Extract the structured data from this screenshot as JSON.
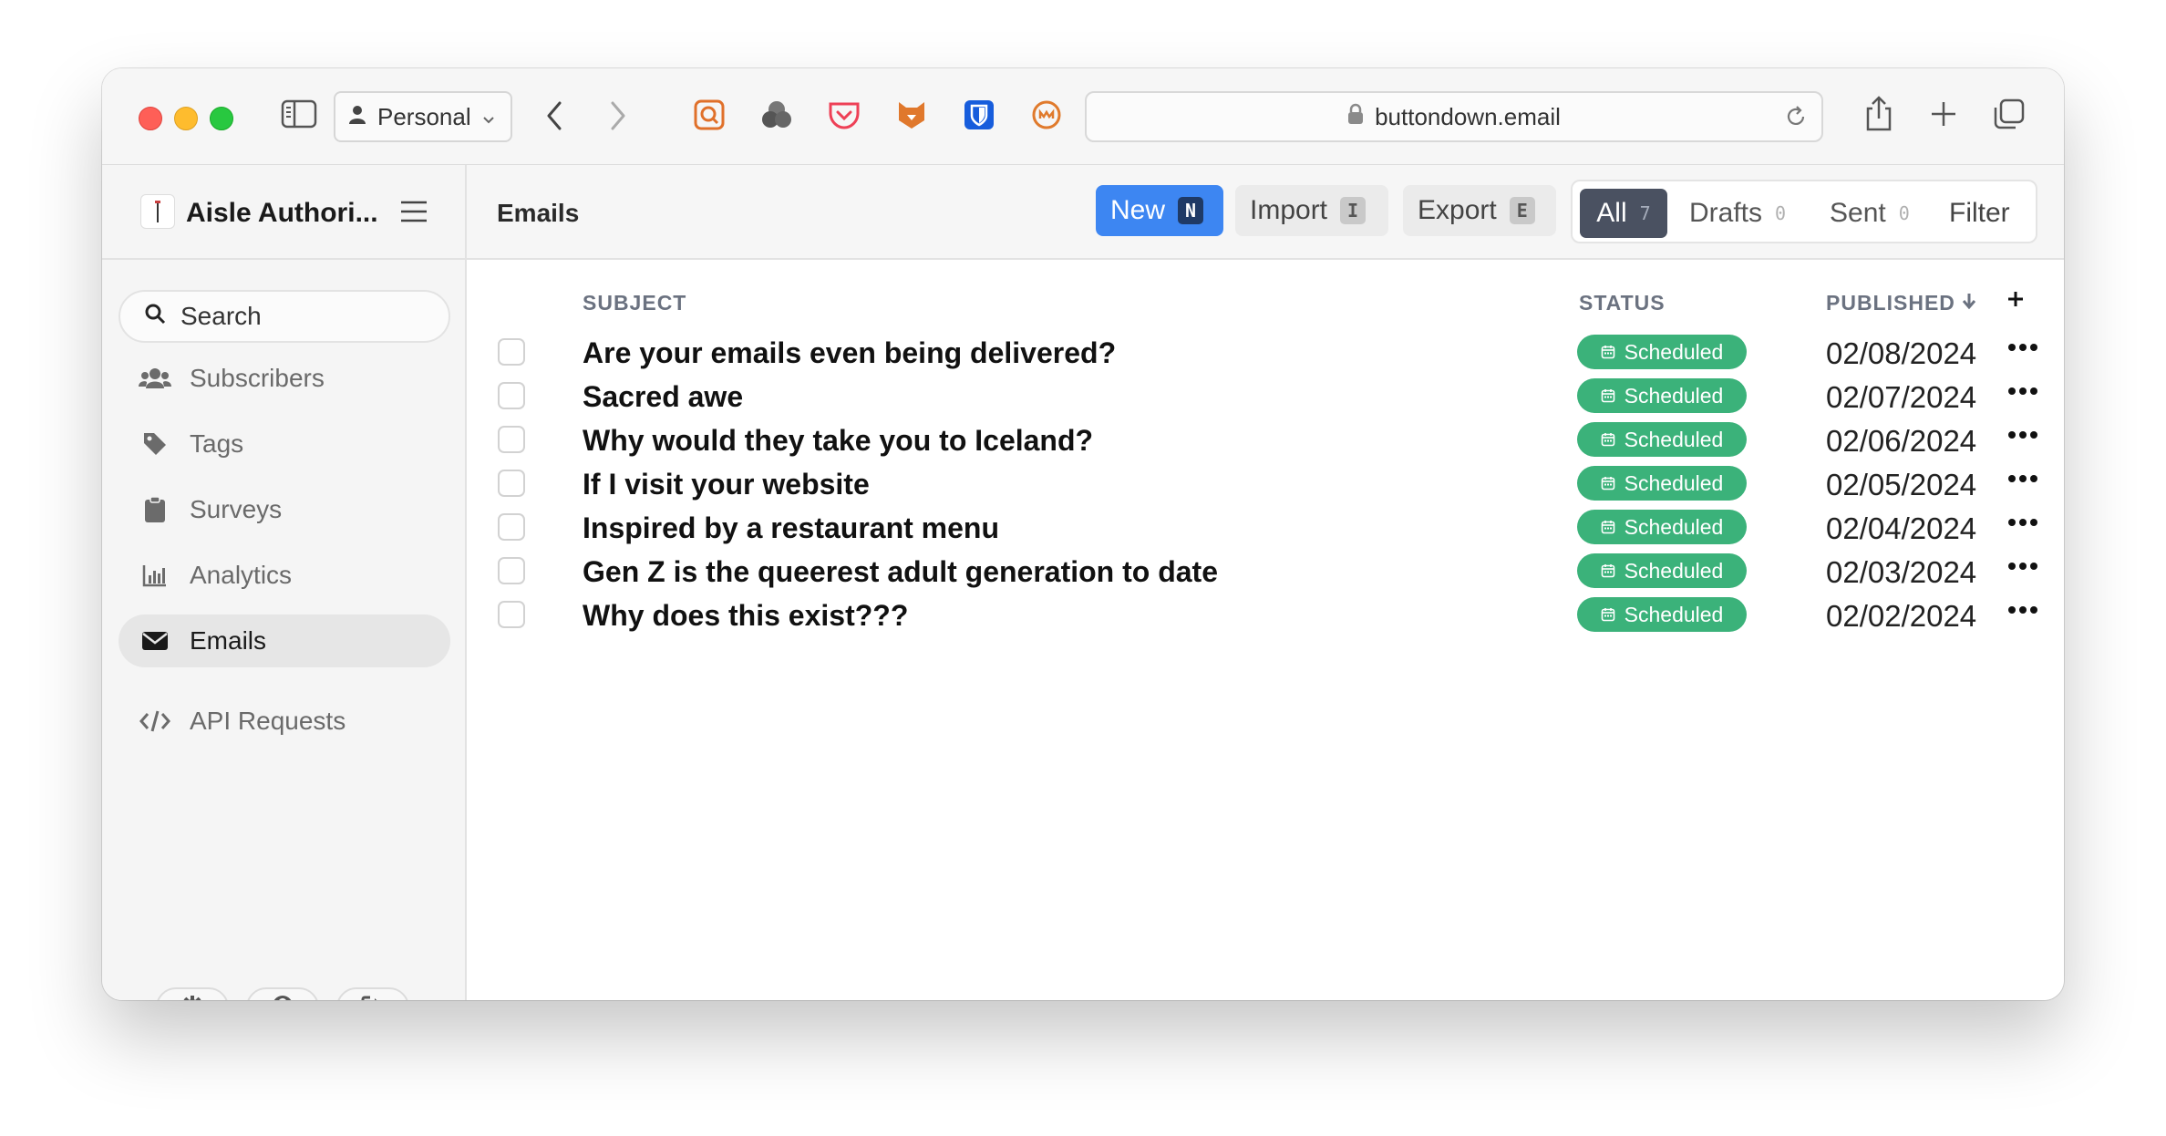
{
  "browser": {
    "profile_label": "Personal",
    "url": "buttondown.email"
  },
  "sidebar": {
    "account_name": "Aisle Authori...",
    "search_label": "Search",
    "items": [
      {
        "label": "Subscribers",
        "icon": "users-icon"
      },
      {
        "label": "Tags",
        "icon": "tag-icon"
      },
      {
        "label": "Surveys",
        "icon": "clipboard-icon"
      },
      {
        "label": "Analytics",
        "icon": "bar-chart-icon"
      },
      {
        "label": "Emails",
        "icon": "envelope-icon",
        "active": true
      },
      {
        "label": "API Requests",
        "icon": "code-icon"
      }
    ]
  },
  "main": {
    "title": "Emails",
    "buttons": {
      "new": {
        "label": "New",
        "shortcut": "N"
      },
      "import": {
        "label": "Import",
        "shortcut": "I"
      },
      "export": {
        "label": "Export",
        "shortcut": "E"
      }
    },
    "filters": {
      "all": {
        "label": "All",
        "count": "7"
      },
      "drafts": {
        "label": "Drafts",
        "count": "0"
      },
      "sent": {
        "label": "Sent",
        "count": "0"
      },
      "filter_label": "Filter"
    },
    "table": {
      "columns": {
        "subject": "SUBJECT",
        "status": "STATUS",
        "published": "PUBLISHED"
      },
      "rows": [
        {
          "subject": "Are your emails even being delivered?",
          "status": "Scheduled",
          "date": "02/08/2024"
        },
        {
          "subject": "Sacred awe",
          "status": "Scheduled",
          "date": "02/07/2024"
        },
        {
          "subject": "Why would they take you to Iceland?",
          "status": "Scheduled",
          "date": "02/06/2024"
        },
        {
          "subject": "If I visit your website",
          "status": "Scheduled",
          "date": "02/05/2024"
        },
        {
          "subject": "Inspired by a restaurant menu",
          "status": "Scheduled",
          "date": "02/04/2024"
        },
        {
          "subject": "Gen Z is the queerest adult generation to date",
          "status": "Scheduled",
          "date": "02/03/2024"
        },
        {
          "subject": "Why does this exist???",
          "status": "Scheduled",
          "date": "02/02/2024"
        }
      ]
    }
  },
  "colors": {
    "accent": "#3d86f2",
    "scheduled_badge": "#3bb27a",
    "active_filter": "#4a5161"
  }
}
